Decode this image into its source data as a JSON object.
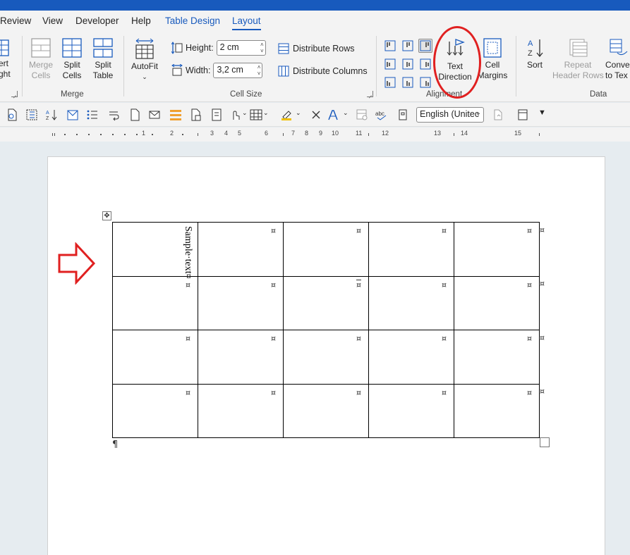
{
  "tabs": [
    {
      "label": "Review"
    },
    {
      "label": "View"
    },
    {
      "label": "Developer"
    },
    {
      "label": "Help"
    },
    {
      "label": "Table Design"
    },
    {
      "label": "Layout"
    }
  ],
  "ribbon": {
    "partial_left": {
      "line1": "ert",
      "line2": "ght"
    },
    "merge_group": {
      "label": "Merge",
      "merge_cells": {
        "line1": "Merge",
        "line2": "Cells"
      },
      "split_cells": {
        "line1": "Split",
        "line2": "Cells"
      },
      "split_table": {
        "line1": "Split",
        "line2": "Table"
      }
    },
    "cell_size_group": {
      "label": "Cell Size",
      "autofit": {
        "label": "AutoFit"
      },
      "height": {
        "label": "Height:",
        "value": "2 cm"
      },
      "width": {
        "label": "Width:",
        "value": "3,2 cm"
      },
      "distribute_rows": "Distribute Rows",
      "distribute_columns": "Distribute Columns"
    },
    "alignment_group": {
      "label": "Alignment",
      "text_direction": {
        "line1": "Text",
        "line2": "Direction"
      },
      "cell_margins": {
        "line1": "Cell",
        "line2": "Margins"
      }
    },
    "data_group": {
      "label": "Data",
      "sort": {
        "label": "Sort"
      },
      "repeat_header_rows": {
        "line1": "Repeat",
        "line2": "Header Rows"
      },
      "convert_to_text": {
        "line1": "Conve",
        "line2": "to Tex"
      }
    }
  },
  "quick_toolbar": {
    "language": "English (Unitec"
  },
  "ruler": {
    "numbers": [
      "1",
      "2",
      "3",
      "4",
      "5",
      "6",
      "7",
      "8",
      "9",
      "10",
      "11",
      "12",
      "13",
      "14",
      "15"
    ]
  },
  "document": {
    "table": {
      "rows": 4,
      "cols": 5,
      "first_cell_text": "Sample·text¤",
      "cell_mark": "¤"
    },
    "pilcrow": "¶"
  },
  "colors": {
    "accent": "#185abd",
    "annotation_red": "#e02020"
  }
}
